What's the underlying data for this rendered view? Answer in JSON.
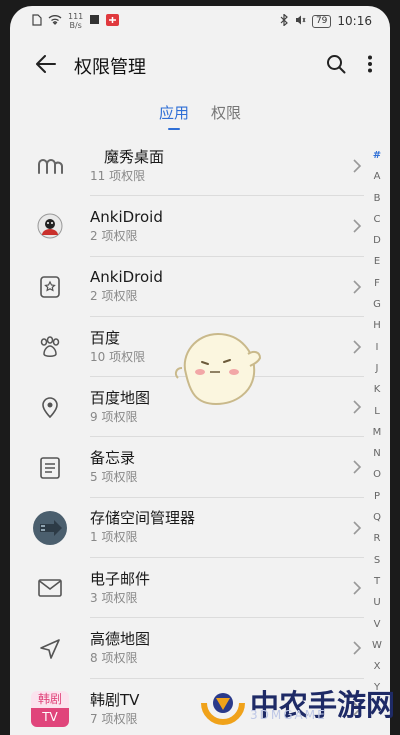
{
  "status_bar": {
    "speed_value": "111",
    "speed_unit": "B/s",
    "battery": "79",
    "time": "10:16"
  },
  "header": {
    "title": "权限管理",
    "back_icon": "arrow-left-icon",
    "search_icon": "search-icon",
    "more_icon": "more-vertical-icon"
  },
  "tabs": [
    {
      "label": "应用",
      "active": true
    },
    {
      "label": "权限",
      "active": false
    }
  ],
  "apps": [
    {
      "name": "魔秀桌面",
      "perms": "11 项权限",
      "icon": "mo-xiu-icon"
    },
    {
      "name": "AnkiDroid",
      "perms": "2 项权限",
      "icon": "anki-avatar-icon"
    },
    {
      "name": "AnkiDroid",
      "perms": "2 项权限",
      "icon": "anki-card-icon"
    },
    {
      "name": "百度",
      "perms": "10 项权限",
      "icon": "baidu-paw-icon"
    },
    {
      "name": "百度地图",
      "perms": "9 项权限",
      "icon": "map-pin-icon"
    },
    {
      "name": "备忘录",
      "perms": "5 项权限",
      "icon": "notes-icon"
    },
    {
      "name": "存储空间管理器",
      "perms": "1 项权限",
      "icon": "storage-manager-icon"
    },
    {
      "name": "电子邮件",
      "perms": "3 项权限",
      "icon": "mail-icon"
    },
    {
      "name": "高德地图",
      "perms": "8 项权限",
      "icon": "navigation-icon"
    },
    {
      "name": "韩剧TV",
      "perms": "7 项权限",
      "icon": "hanju-tv-icon"
    }
  ],
  "index_letters": [
    "#",
    "A",
    "B",
    "C",
    "D",
    "E",
    "F",
    "G",
    "H",
    "I",
    "J",
    "K",
    "L",
    "M",
    "N",
    "O",
    "P",
    "Q",
    "R",
    "S",
    "T",
    "U",
    "V",
    "W",
    "X",
    "Y"
  ],
  "hanju_icon_text": {
    "top": "韩剧",
    "bottom": "TV"
  },
  "watermark": {
    "text": "中农手游网",
    "sub": "3DMGAME"
  },
  "colors": {
    "accent": "#2f6fd6",
    "background": "#f2f2f2",
    "divider": "#dcdcdc"
  }
}
